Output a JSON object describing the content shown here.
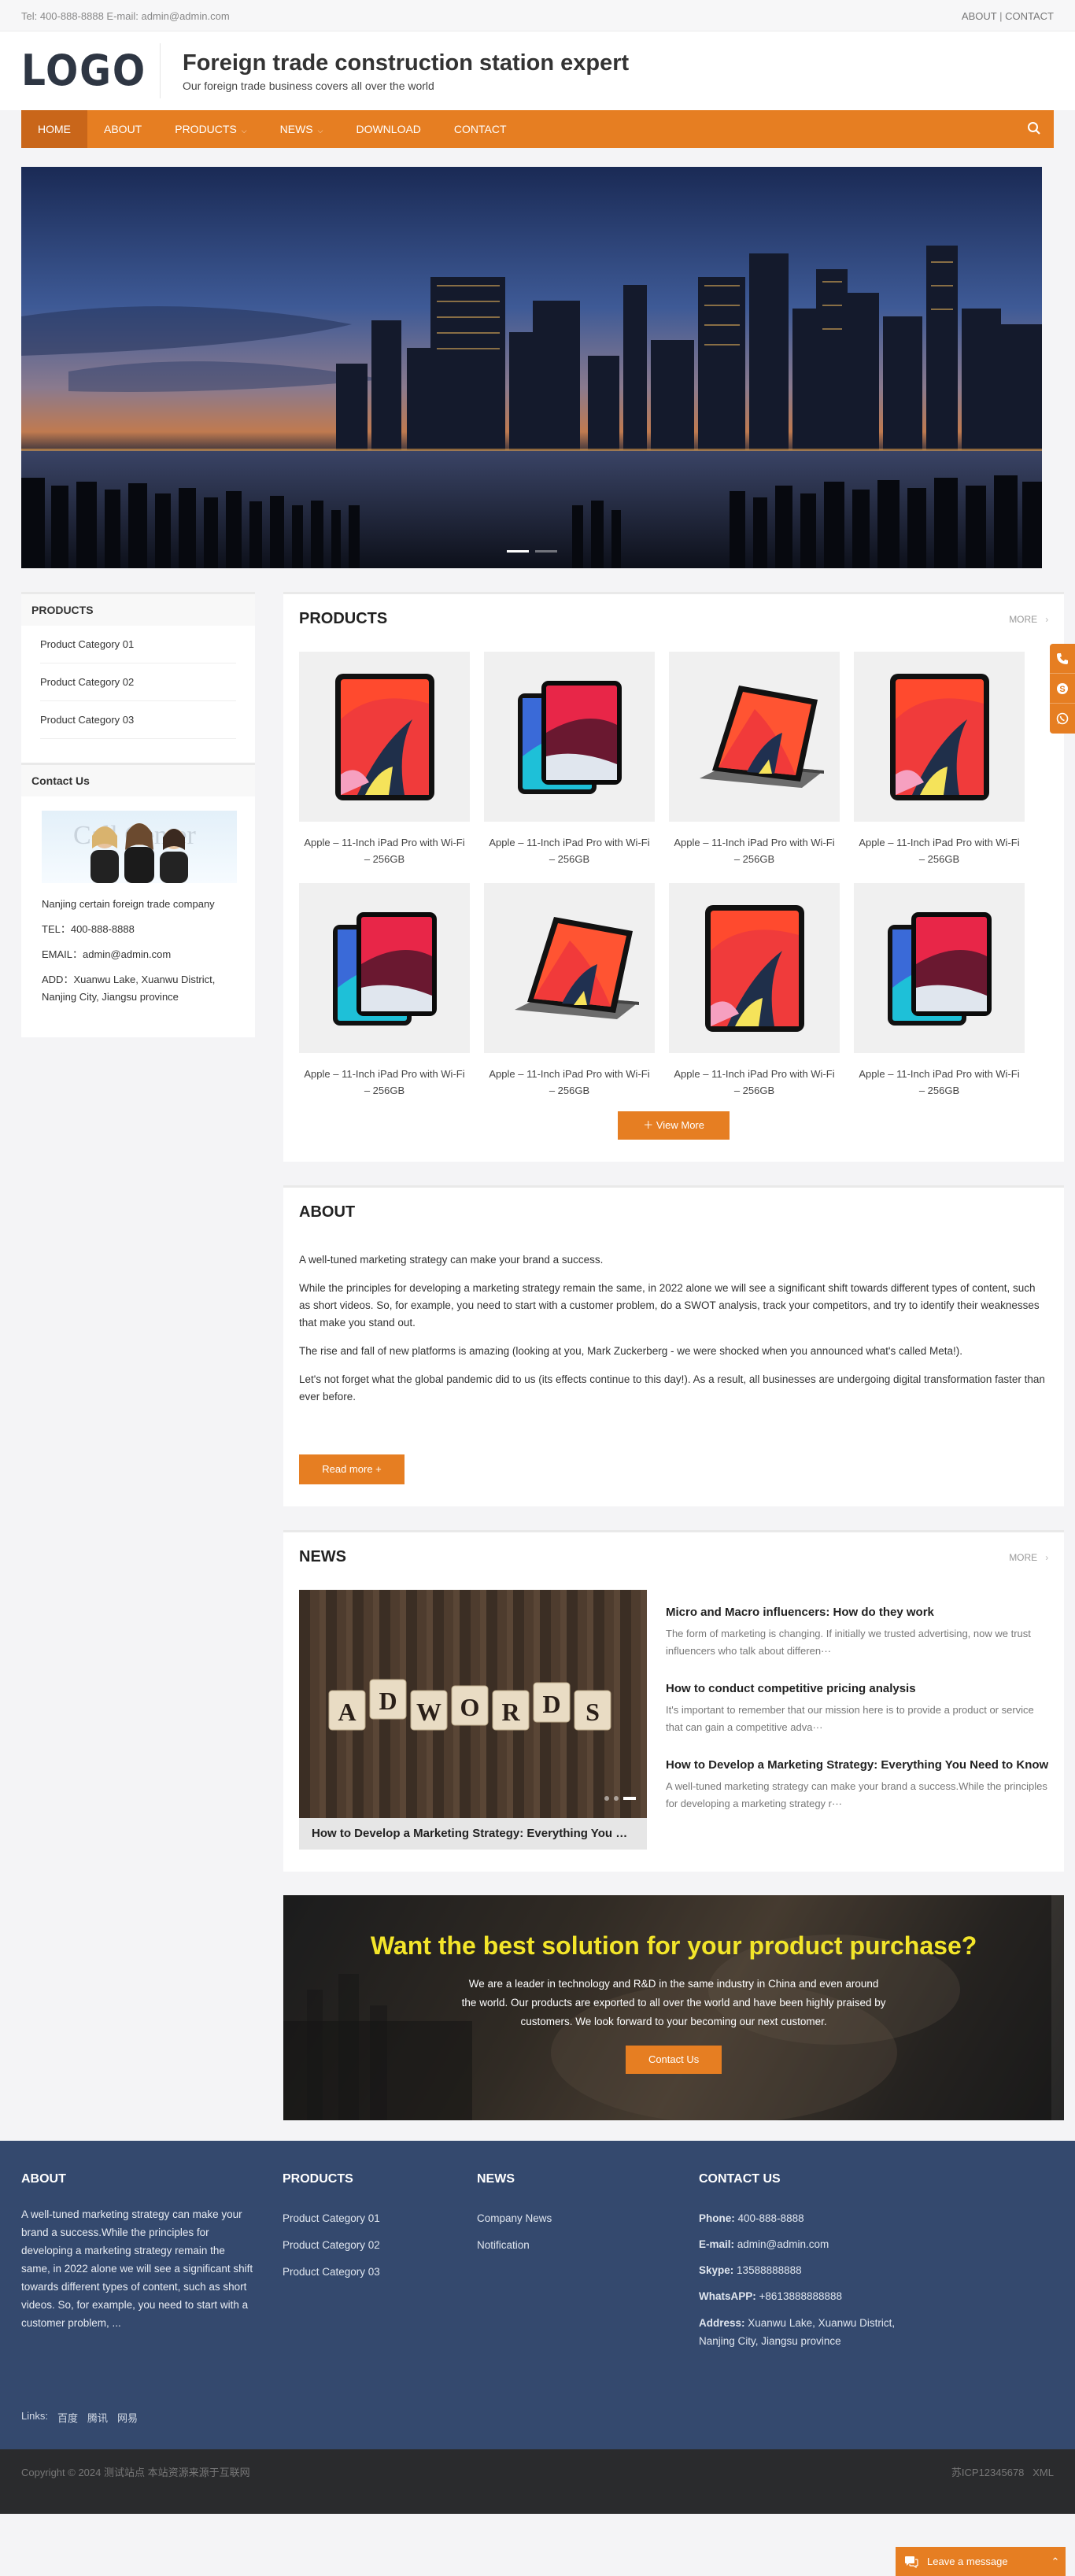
{
  "topbar": {
    "contact_text": "Tel: 400-888-8888 E-mail: admin@admin.com",
    "about_link": "ABOUT",
    "separator": "|",
    "contact_link": "CONTACT"
  },
  "header": {
    "logo_text": "LOGO",
    "title": "Foreign trade construction station expert",
    "subtitle": "Our foreign trade business covers all over the world"
  },
  "nav": {
    "items": [
      {
        "label": "HOME"
      },
      {
        "label": "ABOUT"
      },
      {
        "label": "PRODUCTS",
        "caret": "⌵"
      },
      {
        "label": "NEWS",
        "caret": "⌵"
      },
      {
        "label": "DOWNLOAD"
      },
      {
        "label": "CONTACT"
      }
    ],
    "active_index": 0
  },
  "sidebar": {
    "products_title": "PRODUCTS",
    "categories": [
      "Product Category 01",
      "Product Category 02",
      "Product Category 03"
    ],
    "contact_title": "Contact Us",
    "photo_text": "Call Center",
    "company": "Nanjing certain foreign trade company",
    "tel": "TEL：400-888-8888",
    "email": "EMAIL：admin@admin.com",
    "address": "ADD：Xuanwu Lake, Xuanwu District, Nanjing City, Jiangsu province"
  },
  "products": {
    "title": "PRODUCTS",
    "more": "MORE",
    "items": [
      {
        "name": "Apple – 11-Inch iPad Pro with Wi-Fi – 256GB",
        "variant": "single"
      },
      {
        "name": "Apple – 11-Inch iPad Pro with Wi-Fi – 256GB",
        "variant": "double"
      },
      {
        "name": "Apple – 11-Inch iPad Pro with Wi-Fi – 256GB",
        "variant": "keyboard"
      },
      {
        "name": "Apple – 11-Inch iPad Pro with Wi-Fi – 256GB",
        "variant": "single"
      },
      {
        "name": "Apple – 11-Inch iPad Pro with Wi-Fi – 256GB",
        "variant": "double"
      },
      {
        "name": "Apple – 11-Inch iPad Pro with Wi-Fi – 256GB",
        "variant": "keyboard"
      },
      {
        "name": "Apple – 11-Inch iPad Pro with Wi-Fi – 256GB",
        "variant": "single"
      },
      {
        "name": "Apple – 11-Inch iPad Pro with Wi-Fi – 256GB",
        "variant": "double"
      }
    ],
    "view_more": "View More"
  },
  "about": {
    "title": "ABOUT",
    "paragraphs": [
      "A well-tuned marketing strategy can make your brand a success.",
      "While the principles for developing a marketing strategy remain the same, in 2022 alone we will see a significant shift towards different types of content, such as short videos. So, for example, you need to start with a customer problem, do a SWOT analysis, track your competitors, and try to identify their weaknesses that make you stand out.",
      "The rise and fall of new platforms is amazing (looking at you, Mark Zuckerberg - we were shocked when you announced what's called Meta!).",
      "Let's not forget what the global pandemic did to us (its effects continue to this day!). As a result, all businesses are undergoing digital transformation faster than ever before."
    ],
    "read_more": "Read more +"
  },
  "news": {
    "title": "NEWS",
    "more": "MORE",
    "featured_caption": "How to Develop a Marketing Strategy: Everything You Need to Know",
    "featured_image_text": [
      "A",
      "D",
      "W",
      "O",
      "R",
      "D",
      "S"
    ],
    "items": [
      {
        "title": "Micro and Macro influencers: How do they work",
        "excerpt": "The form of marketing is changing. If initially we trusted advertising, now we trust influencers who talk about differen···"
      },
      {
        "title": "How to conduct competitive pricing analysis",
        "excerpt": "It's important to remember that our mission here is to provide a product or service that can gain a competitive adva···"
      },
      {
        "title": "How to Develop a Marketing Strategy: Everything You Need to Know",
        "excerpt": "A well-tuned marketing strategy can make your brand a success.While the principles for developing a marketing strategy r···"
      }
    ]
  },
  "cta": {
    "title": "Want the best solution for your product purchase?",
    "text": "We are a leader in technology and R&D in the same industry in China and even around the world. Our products are exported to all over the world and have been highly praised by customers. We look forward to your becoming our next customer.",
    "button": "Contact Us"
  },
  "footer": {
    "about_title": "ABOUT",
    "about_text": "A well-tuned marketing strategy can make your brand a success.While the principles for developing a marketing strategy remain the same, in 2022 alone we will see a significant shift towards different types of content, such as short videos. So, for example, you need to start with a customer problem, ...",
    "products_title": "PRODUCTS",
    "products": [
      "Product Category 01",
      "Product Category 02",
      "Product Category 03"
    ],
    "news_title": "NEWS",
    "news": [
      "Company News",
      "Notification"
    ],
    "contact_title": "CONTACT US",
    "contact": [
      {
        "label": "Phone:",
        "value": "400-888-8888"
      },
      {
        "label": "E-mail:",
        "value": "admin@admin.com"
      },
      {
        "label": "Skype:",
        "value": "13588888888"
      },
      {
        "label": "WhatsAPP:",
        "value": "+8613888888888"
      },
      {
        "label": "Address:",
        "value": "Xuanwu Lake, Xuanwu District, Nanjing City, Jiangsu province"
      }
    ],
    "links_label": "Links:",
    "links": [
      "百度",
      "腾讯",
      "网易"
    ],
    "copyright": "Copyright © 2024 测试站点 本站资源来源于互联网",
    "icp": "苏ICP12345678",
    "xml": "XML"
  },
  "message_bar": {
    "label": "Leave a message"
  },
  "colors": {
    "accent": "#e67e22",
    "footer_bg": "#34496e",
    "cta_title": "#f3e52a"
  }
}
